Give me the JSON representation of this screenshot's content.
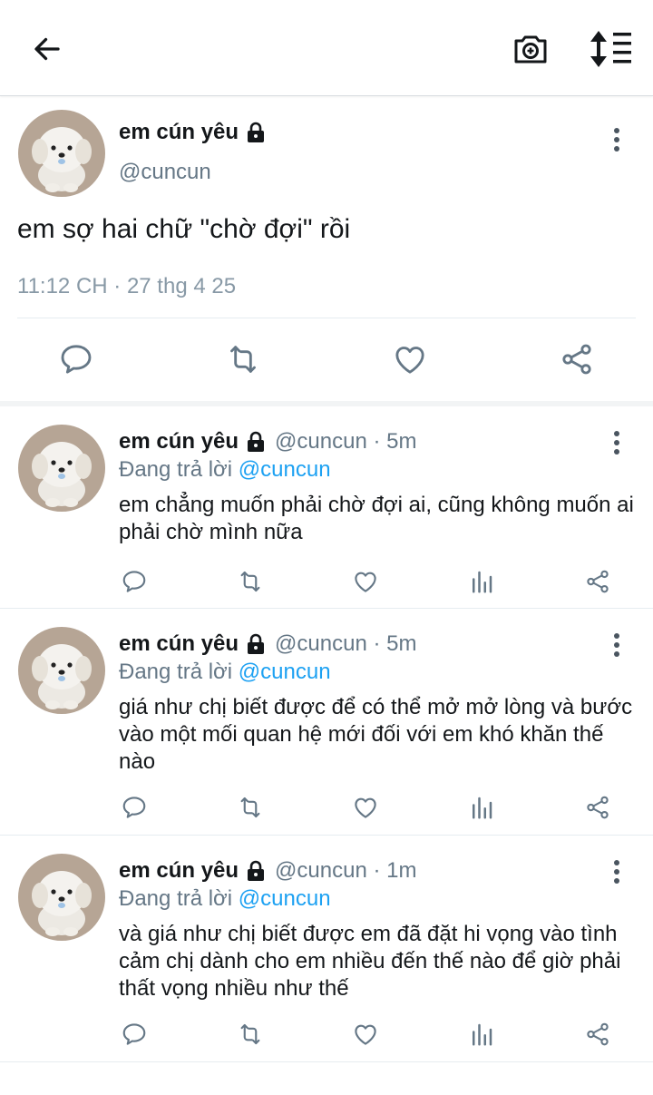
{
  "header": {
    "back_icon": "arrow-left-icon",
    "camera_icon": "camera-plus-icon",
    "sort_icon": "sort-lines-icon"
  },
  "main": {
    "name": "em cún yêu",
    "handle": "@cuncun",
    "text": "em sợ hai chữ \"chờ đợi\" rồi",
    "time": "11:12 CH · 27 thg 4 25"
  },
  "replies": [
    {
      "name": "em cún yêu",
      "meta": "@cuncun · 5m",
      "replying_label": "Đang trả lời",
      "replying_to": "@cuncun",
      "text": "em chẳng muốn phải chờ đợi ai, cũng không muốn ai phải chờ mình nữa"
    },
    {
      "name": "em cún yêu",
      "meta": "@cuncun · 5m",
      "replying_label": "Đang trả lời",
      "replying_to": "@cuncun",
      "text": "giá như chị biết được để có thể mở mở lòng và bước vào một mối quan hệ mới đối với em khó khăn thế nào"
    },
    {
      "name": "em cún yêu",
      "meta": "@cuncun · 1m",
      "replying_label": "Đang trả lời",
      "replying_to": "@cuncun",
      "text": "và giá như chị biết được em đã đặt hi vọng vào tình cảm chị dành cho em nhiều đến thế nào để giờ phải thất vọng nhiều như thế"
    }
  ],
  "colors": {
    "link": "#1da1f2",
    "secondary": "#657786",
    "icon": "#657786"
  }
}
